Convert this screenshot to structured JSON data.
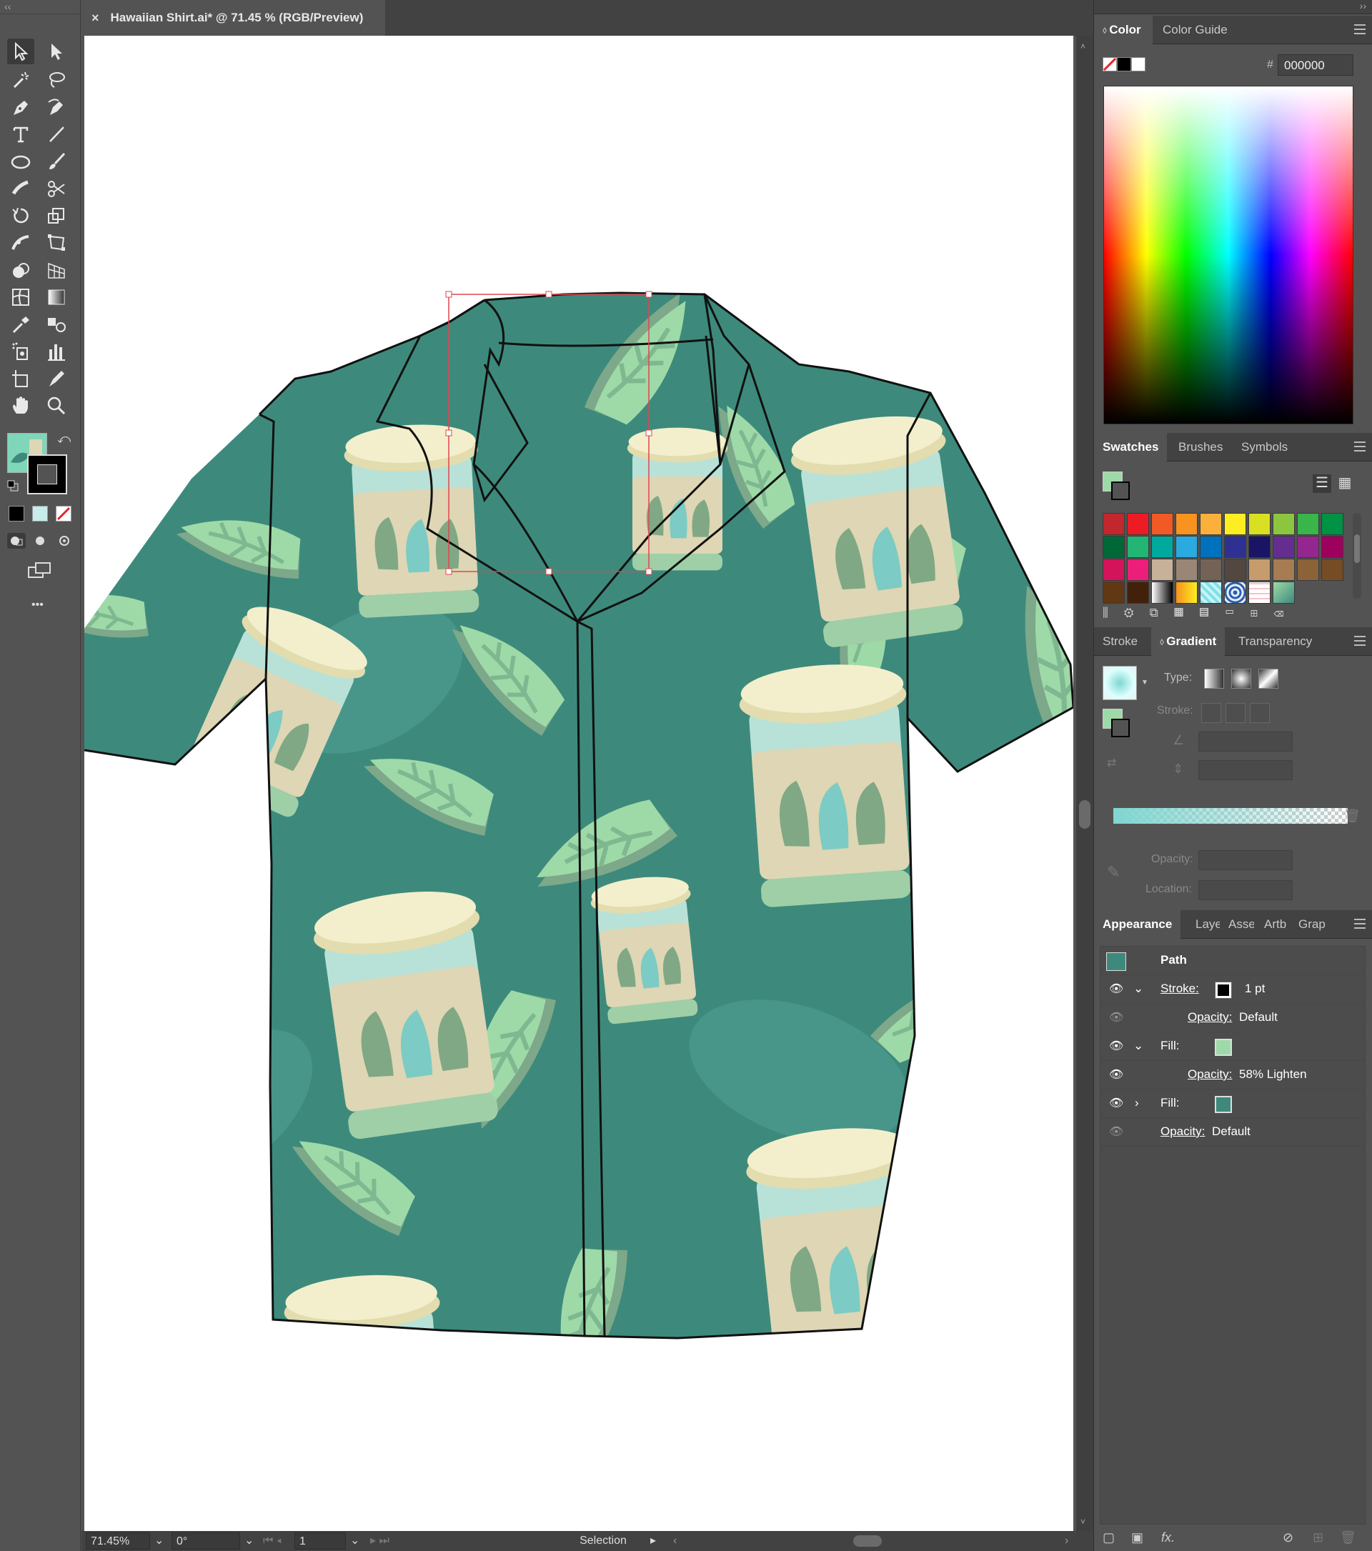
{
  "document": {
    "tab_title": "Hawaiian Shirt.ai* @ 71.45 % (RGB/Preview)",
    "close_glyph": "×"
  },
  "toolbar": {
    "collapse_glyph": "‹‹",
    "more_glyph": "•••",
    "tools": [
      "selection-tool",
      "direct-selection-tool",
      "magic-wand-tool",
      "lasso-tool",
      "pen-tool",
      "curvature-tool",
      "type-tool",
      "line-segment-tool",
      "ellipse-tool",
      "paintbrush-tool",
      "shaper-tool",
      "scissors-tool",
      "rotate-tool",
      "scale-tool",
      "warp-tool",
      "free-transform-tool",
      "shape-builder-tool",
      "perspective-grid-tool",
      "mesh-tool",
      "gradient-tool",
      "eyedropper-tool",
      "blend-tool",
      "symbol-sprayer-tool",
      "column-graph-tool",
      "artboard-tool",
      "slice-tool",
      "hand-tool",
      "zoom-tool"
    ]
  },
  "status": {
    "zoom": "71.45%",
    "rotation": "0°",
    "artboard_num": "1",
    "mode": "Selection"
  },
  "color_panel": {
    "tabs": [
      "Color",
      "Color Guide"
    ],
    "hex_label": "#",
    "hex_value": "000000"
  },
  "swatches_panel": {
    "tabs": [
      "Swatches",
      "Brushes",
      "Symbols"
    ],
    "rows": [
      [
        "#c1272d",
        "#ed1c24",
        "#f15a24",
        "#f7931e",
        "#fbb03b",
        "#fcee21",
        "#d9e021",
        "#8cc63f",
        "#39b54a",
        "#009245"
      ],
      [
        "#006837",
        "#22b573",
        "#00a99d",
        "#29abe2",
        "#0071bc",
        "#2e3192",
        "#1b1464",
        "#662d91",
        "#93278f",
        "#9e005d"
      ],
      [
        "#d4145a",
        "#ed1e79",
        "#c7b299",
        "#998675",
        "#736357",
        "#534741",
        "#c69c6d",
        "#a67c52",
        "#8c6239",
        "#754c24"
      ],
      [
        "#603813",
        "#42210b",
        "gradient-bw",
        "gradient-orange",
        "pattern-cyan",
        "pattern-blue",
        "pattern-pink",
        "pattern-shirt"
      ]
    ]
  },
  "gradient_panel": {
    "tabs": [
      "Stroke",
      "Gradient",
      "Transparency"
    ],
    "type_label": "Type:",
    "stroke_label": "Stroke:",
    "opacity_label": "Opacity:",
    "location_label": "Location:",
    "gradient_start": "#7fd6d0"
  },
  "appearance_panel": {
    "tabs": [
      "Appearance",
      "Laye",
      "Asse",
      "Artb",
      "Grap"
    ],
    "object": "Path",
    "rows": [
      {
        "label": "Stroke:",
        "value": "1 pt",
        "expanded": true
      },
      {
        "label": "Opacity:",
        "value": "Default",
        "indent": true
      },
      {
        "label": "Fill:",
        "value": "",
        "expanded": true
      },
      {
        "label": "Opacity:",
        "value": "58% Lighten",
        "indent": true
      },
      {
        "label": "Fill:",
        "value": "",
        "expanded": false
      },
      {
        "label": "Opacity:",
        "value": "Default",
        "indent": false
      }
    ]
  },
  "colors": {
    "shirt_base": "#3d8a7c",
    "leaf_light": "#9edaa8",
    "leaf_shadow": "#7ea88a",
    "jar_lid": "#f3efcc",
    "jar_glass": "#b8e2d8",
    "jar_label": "#ded6b4",
    "pickle": "#80a884",
    "selection": "#e0454f"
  }
}
